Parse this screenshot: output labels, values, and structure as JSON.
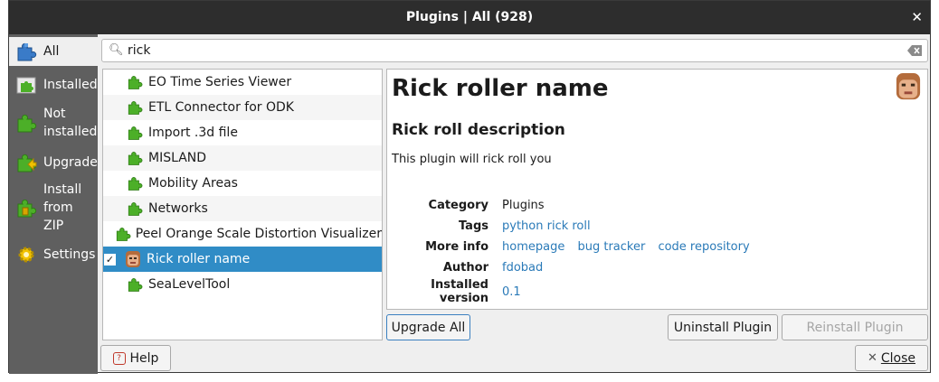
{
  "window": {
    "title": "Plugins | All (928)"
  },
  "search": {
    "value": "rick",
    "placeholder": ""
  },
  "sidebar": {
    "items": [
      {
        "label": "All",
        "icon": "puzzle-blue-icon"
      },
      {
        "label": "Installed",
        "icon": "puzzle-installed-icon"
      },
      {
        "label": "Not\ninstalled",
        "icon": "puzzle-green-icon"
      },
      {
        "label": "Upgradeable",
        "icon": "puzzle-upgrade-icon"
      },
      {
        "label": "Install\nfrom\nZIP",
        "icon": "zip-icon"
      },
      {
        "label": "Settings",
        "icon": "gear-icon"
      }
    ]
  },
  "plugins": [
    {
      "label": "EO Time Series Viewer"
    },
    {
      "label": "ETL Connector for ODK"
    },
    {
      "label": "Import .3d file"
    },
    {
      "label": "MISLAND"
    },
    {
      "label": "Mobility Areas"
    },
    {
      "label": "Networks"
    },
    {
      "label": "Peel Orange Scale Distortion Visualizer"
    },
    {
      "label": "Rick roller name",
      "checked": "✓"
    },
    {
      "label": "SeaLevelTool"
    }
  ],
  "details": {
    "title": "Rick roller name",
    "subtitle": "Rick roll description",
    "description": "This plugin will rick roll you",
    "category_label": "Category",
    "category": "Plugins",
    "tags_label": "Tags",
    "tags": "python rick roll",
    "more_info_label": "More info",
    "homepage": "homepage",
    "bug_tracker": "bug tracker",
    "code_repository": "code repository",
    "author_label": "Author",
    "author": "fdobad",
    "installed_version_label": "Installed version",
    "installed_version": "0.1"
  },
  "buttons": {
    "upgrade_all": "Upgrade All",
    "uninstall": "Uninstall Plugin",
    "reinstall": "Reinstall Plugin",
    "help": "Help",
    "close": "Close"
  },
  "colors": {
    "selection": "#308cc6",
    "sidebar": "#5f5f5f",
    "link": "#2a7ab8",
    "puzzle_green": "#4caf28"
  }
}
